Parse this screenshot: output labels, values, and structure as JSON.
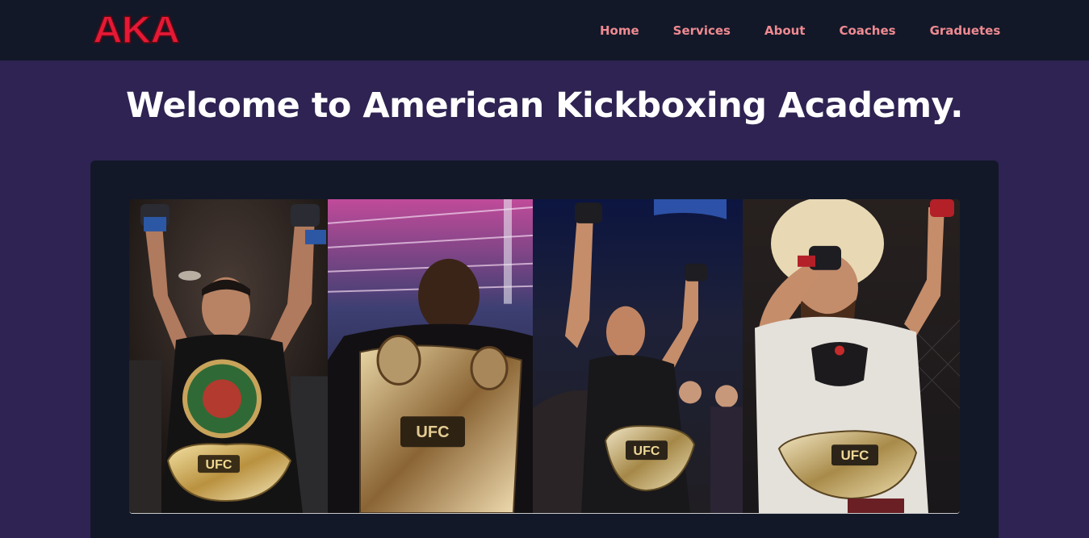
{
  "navbar": {
    "logo_text": "AKA",
    "links": [
      "Home",
      "Services",
      "About",
      "Coaches",
      "Graduetes"
    ]
  },
  "hero": {
    "title": "Welcome to American Kickboxing Academy."
  },
  "gallery": {
    "photos": [
      {
        "subject": "champion-fighter-1",
        "belt": "UFC"
      },
      {
        "subject": "champion-fighter-2",
        "belt": "UFC"
      },
      {
        "subject": "champion-fighter-3",
        "belt": "UFC"
      },
      {
        "subject": "champion-fighter-4",
        "belt": "UFC"
      }
    ]
  },
  "colors": {
    "navbar_bg": "#121828",
    "page_bg": "#2e2352",
    "nav_link": "#ef8a91",
    "logo_red": "#e51937",
    "title_text": "#ffffff"
  }
}
